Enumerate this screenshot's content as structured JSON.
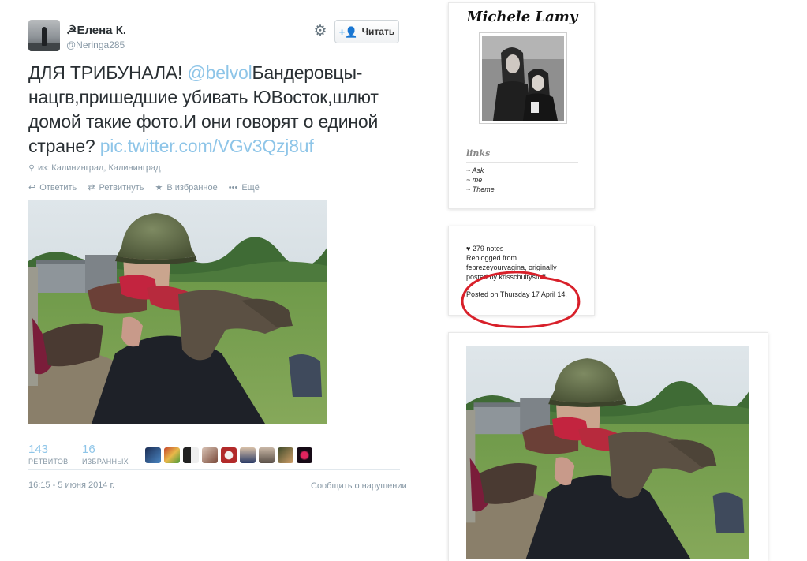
{
  "tweet": {
    "display_name": "☭Елена К.",
    "handle": "@Neringa285",
    "follow_label": "Читать",
    "text_before_mention": "ДЛЯ ТРИБУНАЛА! ",
    "mention": "@belvol",
    "text_after_mention": "Бандеровцы-нацгв,пришедшие убивать ЮВосток,шлют домой такие фото.И они говорят о единой стране? ",
    "pic_link": "pic.twitter.com/VGv3Qzj8uf",
    "location": "из: Калининград, Калининград",
    "actions": {
      "reply": "Ответить",
      "retweet": "Ретвитнуть",
      "favorite": "В избранное",
      "more": "Ещё"
    },
    "retweets_count": "143",
    "retweets_label": "РЕТВИТОВ",
    "favorites_count": "16",
    "favorites_label": "ИЗБРАННЫХ",
    "timestamp": "16:15 - 5 июня 2014 г.",
    "report_label": "Сообщить о нарушении"
  },
  "tumblr": {
    "blog_title": "Michele Lamy",
    "links_heading": "links",
    "links": [
      "~ Ask",
      "~ me",
      "~ Theme"
    ],
    "notes": "♥ 279 notes",
    "reblog_lines": [
      "Reblogged from",
      "febrezeyourvagina, originally",
      "posted by krisschultystuff."
    ],
    "posted_on": "Posted on Thursday 17 April 14."
  },
  "colors": {
    "link_blue": "#8ec5e8",
    "muted_gray": "#8899a6",
    "annotation_red": "#d8202a"
  },
  "icons": {
    "gear": "gear-icon",
    "follow": "follow-user-icon",
    "location": "location-pin-icon",
    "reply": "reply-icon",
    "retweet": "retweet-icon",
    "favorite": "star-icon",
    "more": "more-dots-icon"
  }
}
